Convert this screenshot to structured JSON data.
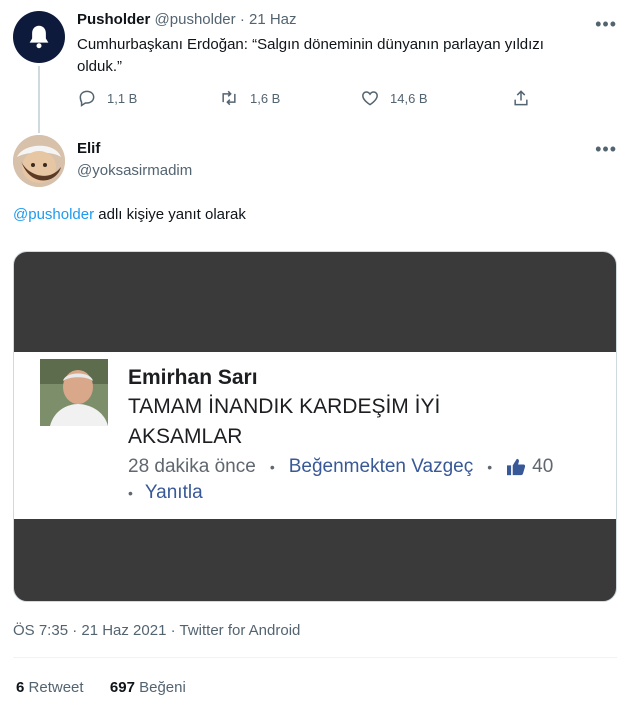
{
  "tweet1": {
    "name": "Pusholder",
    "handle": "@pusholder",
    "separator": "·",
    "date": "21 Haz",
    "text": "Cumhurbaşkanı Erdoğan: “Salgın döneminin dünyanın parlayan yıldızı olduk.”",
    "more": "•••",
    "actions": {
      "reply_count": "1,1 B",
      "retweet_count": "1,6 B",
      "like_count": "14,6 B"
    }
  },
  "reply": {
    "name": "Elif",
    "handle": "@yoksasirmadim",
    "more": "•••",
    "reply_to_handle": "@pusholder",
    "reply_to_suffix": " adlı kişiye yanıt olarak",
    "media": {
      "commenter_name": "Emirhan Sarı",
      "comment_text": "TAMAM İNANDIK KARDEŞİM İYİ AKSAMLAR",
      "time_ago": "28 dakika önce",
      "dot": "•",
      "unlike_label": "Beğenmekten Vazgeç",
      "like_count": "40",
      "reply_label": "Yanıtla"
    },
    "timestamp": "ÖS 7:35 · 21 Haz 2021 · Twitter for Android",
    "retweets_count": "6",
    "retweets_label": "Retweet",
    "likes_count": "697",
    "likes_label": "Beğeni"
  },
  "colors": {
    "link": "#1d9bf0",
    "muted": "#536471",
    "bell_avatar_bg": "#0e1a3b"
  }
}
